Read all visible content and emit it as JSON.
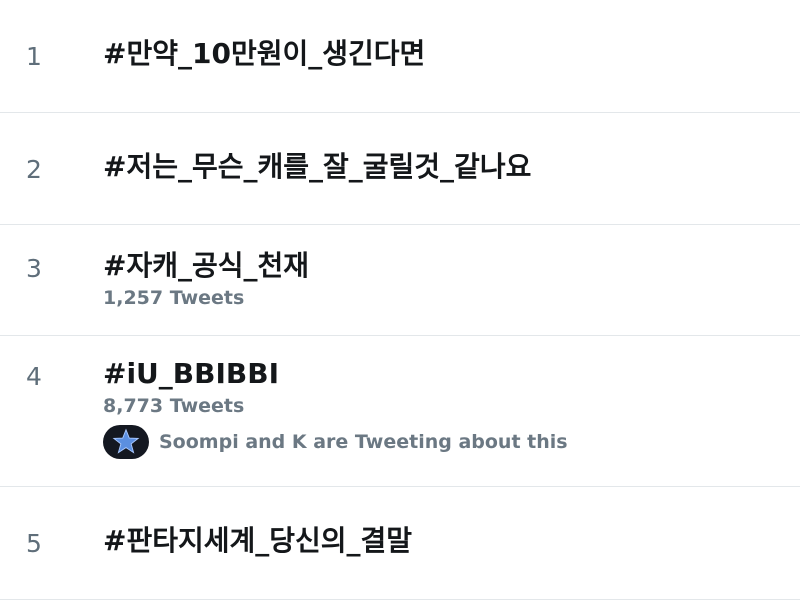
{
  "trends": [
    {
      "rank": "1",
      "topic": "#만약_10만원이_생긴다면"
    },
    {
      "rank": "2",
      "topic": "#저는_무슨_캐를_잘_굴릴것_같나요"
    },
    {
      "rank": "3",
      "topic": "#자캐_공식_천재",
      "tweets": "1,257 Tweets"
    },
    {
      "rank": "4",
      "topic": "#iU_BBIBBI",
      "tweets": "8,773 Tweets",
      "context": "Soompi and K are Tweeting about this",
      "avatar_icon": "star-avatar-icon"
    },
    {
      "rank": "5",
      "topic": "#판타지세계_당신의_결말"
    }
  ],
  "colors": {
    "topic": "#14171a",
    "secondary": "#6b7883",
    "divider": "#e3e7ea",
    "star": "#5b8fe0"
  }
}
